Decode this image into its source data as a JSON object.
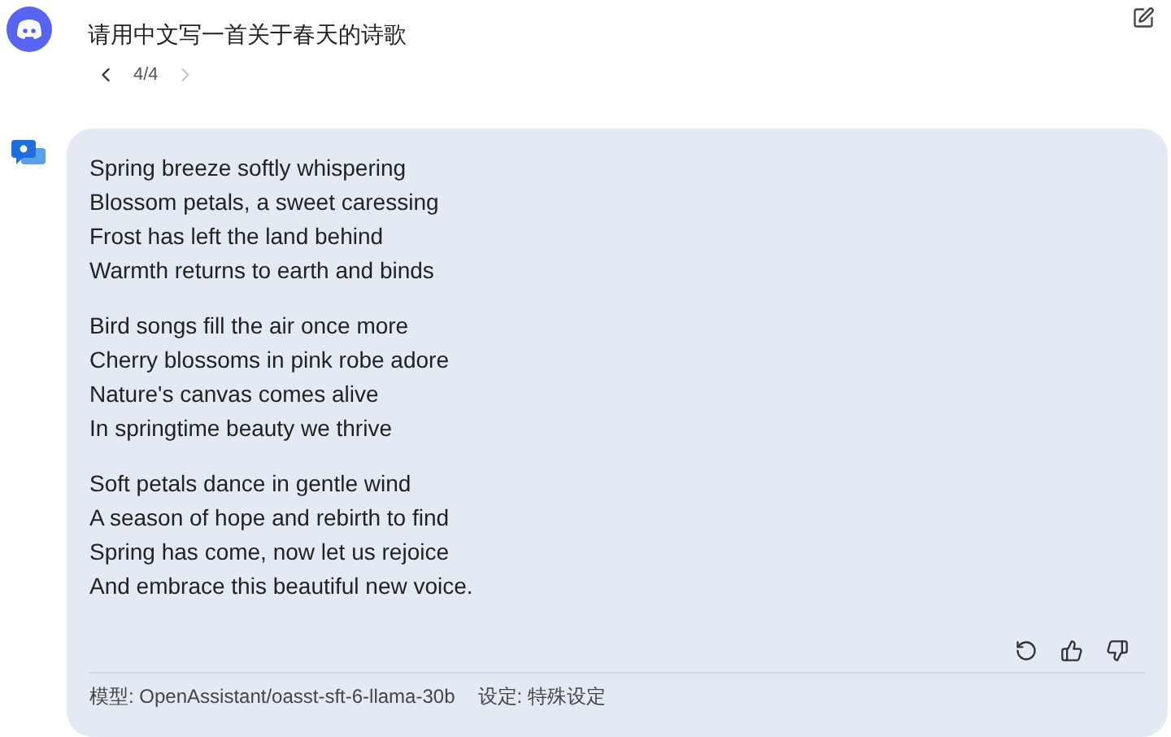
{
  "user_message": {
    "text": "请用中文写一首关于春天的诗歌"
  },
  "pager": {
    "prev": {
      "disabled": false
    },
    "label": "4/4",
    "next": {
      "disabled": true
    }
  },
  "reply": {
    "stanzas": [
      [
        "Spring breeze softly whispering",
        "Blossom petals, a sweet caressing",
        "Frost has left the land behind",
        "Warmth returns to earth and binds"
      ],
      [
        "Bird songs fill the air once more",
        "Cherry blossoms in pink robe adore",
        "Nature's canvas comes alive",
        "In springtime beauty we thrive"
      ],
      [
        "Soft petals dance in gentle wind",
        "A season of hope and rebirth to find",
        "Spring has come, now let us rejoice",
        "And embrace this beautiful new voice."
      ]
    ],
    "footer": {
      "model": "模型: OpenAssistant/oasst-sft-6-llama-30b",
      "settings": "设定: 特殊设定"
    }
  }
}
